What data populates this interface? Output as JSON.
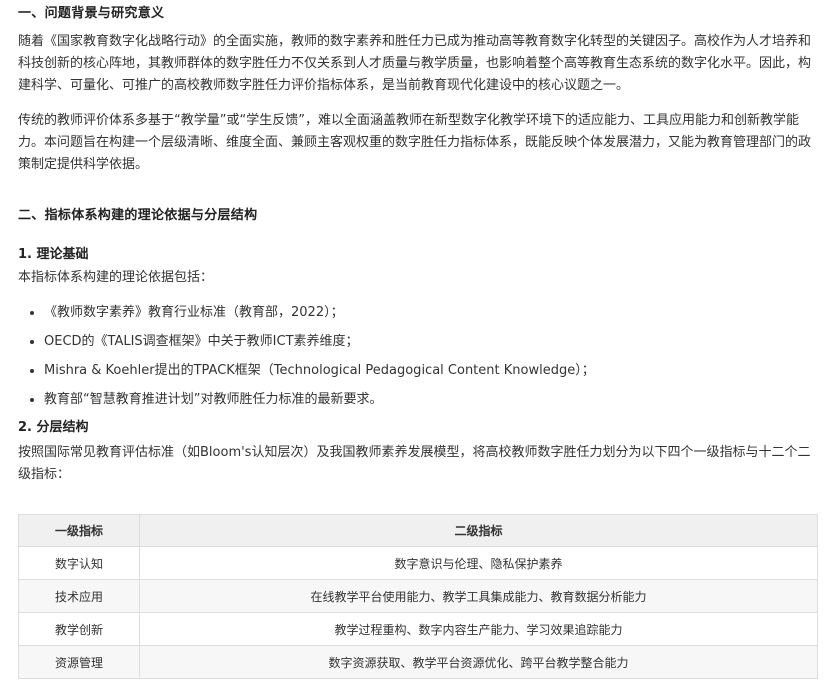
{
  "section1": {
    "title": "一、问题背景与研究意义",
    "para1": "随着《国家教育数字化战略行动》的全面实施，教师的数字素养和胜任力已成为推动高等教育数字化转型的关键因子。高校作为人才培养和科技创新的核心阵地，其教师群体的数字胜任力不仅关系到人才质量与教学质量，也影响着整个高等教育生态系统的数字化水平。因此，构建科学、可量化、可推广的高校教师数字胜任力评价指标体系，是当前教育现代化建设中的核心议题之一。",
    "para2": "传统的教师评价体系多基于“教学量”或“学生反馈”，难以全面涵盖教师在新型数字化教学环境下的适应能力、工具应用能力和创新教学能力。本问题旨在构建一个层级清晰、维度全面、兼顾主客观权重的数字胜任力指标体系，既能反映个体发展潜力，又能为教育管理部门的政策制定提供科学依据。"
  },
  "section2": {
    "title": "二、指标体系构建的理论依据与分层结构",
    "theory": {
      "title": "1. 理论基础",
      "intro": "本指标体系构建的理论依据包括：",
      "items": [
        "《教师数字素养》教育行业标准（教育部，2022）；",
        "OECD的《TALIS调查框架》中关于教师ICT素养维度；",
        "Mishra & Koehler提出的TPACK框架（Technological Pedagogical Content Knowledge）；",
        "教育部“智慧教育推进计划”对教师胜任力标准的最新要求。"
      ]
    },
    "layers": {
      "title": "2. 分层结构",
      "intro": "按照国际常见教育评估标准（如Bloom's认知层次）及我国教师素养发展模型，将高校教师数字胜任力划分为以下四个一级指标与十二个二级指标：",
      "table": {
        "headers": [
          "一级指标",
          "二级指标"
        ],
        "rows": [
          [
            "数字认知",
            "数字意识与伦理、隐私保护素养"
          ],
          [
            "技术应用",
            "在线教学平台使用能力、教学工具集成能力、教育数据分析能力"
          ],
          [
            "教学创新",
            "教学过程重构、数字内容生产能力、学习效果追踪能力"
          ],
          [
            "资源管理",
            "数字资源获取、教学平台资源优化、跨平台教学整合能力"
          ]
        ]
      }
    }
  }
}
